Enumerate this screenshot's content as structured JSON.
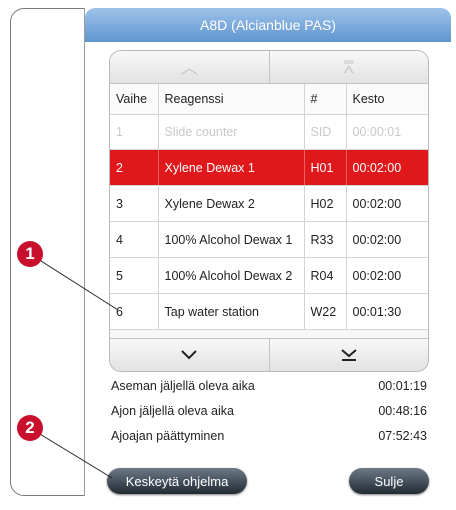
{
  "dialog": {
    "title": "A8D (Alcianblue PAS)"
  },
  "table": {
    "headers": [
      "Vaihe",
      "Reagenssi",
      "#",
      "Kesto"
    ],
    "rows": [
      [
        "1",
        "Slide counter",
        "SID",
        "00:00:01"
      ],
      [
        "2",
        "Xylene Dewax 1",
        "H01",
        "00:02:00"
      ],
      [
        "3",
        "Xylene Dewax 2",
        "H02",
        "00:02:00"
      ],
      [
        "4",
        "100% Alcohol Dewax 1",
        "R33",
        "00:02:00"
      ],
      [
        "5",
        "100% Alcohol Dewax 2",
        "R04",
        "00:02:00"
      ],
      [
        "6",
        "Tap water station",
        "W22",
        "00:01:30"
      ]
    ],
    "selected_step": "2"
  },
  "scroll": {
    "up_icon": "chevron-up-icon",
    "top_icon": "chevron-double-up-icon",
    "down_icon": "chevron-down-icon",
    "bottom_icon": "chevron-double-down-icon"
  },
  "info": {
    "station_remaining_label": "Aseman jäljellä oleva aika",
    "station_remaining_value": "00:01:19",
    "run_remaining_label": "Ajon jäljellä oleva aika",
    "run_remaining_value": "00:48:16",
    "run_end_label": "Ajoajan päättyminen",
    "run_end_value": "07:52:43"
  },
  "buttons": {
    "pause_program": "Keskeytä ohjelma",
    "close": "Sulje"
  },
  "callouts": {
    "first": "1",
    "second": "2"
  },
  "colors": {
    "title_bar": "#6fa0d6",
    "selected_row": "#e0171b",
    "callout": "#c8102e"
  }
}
